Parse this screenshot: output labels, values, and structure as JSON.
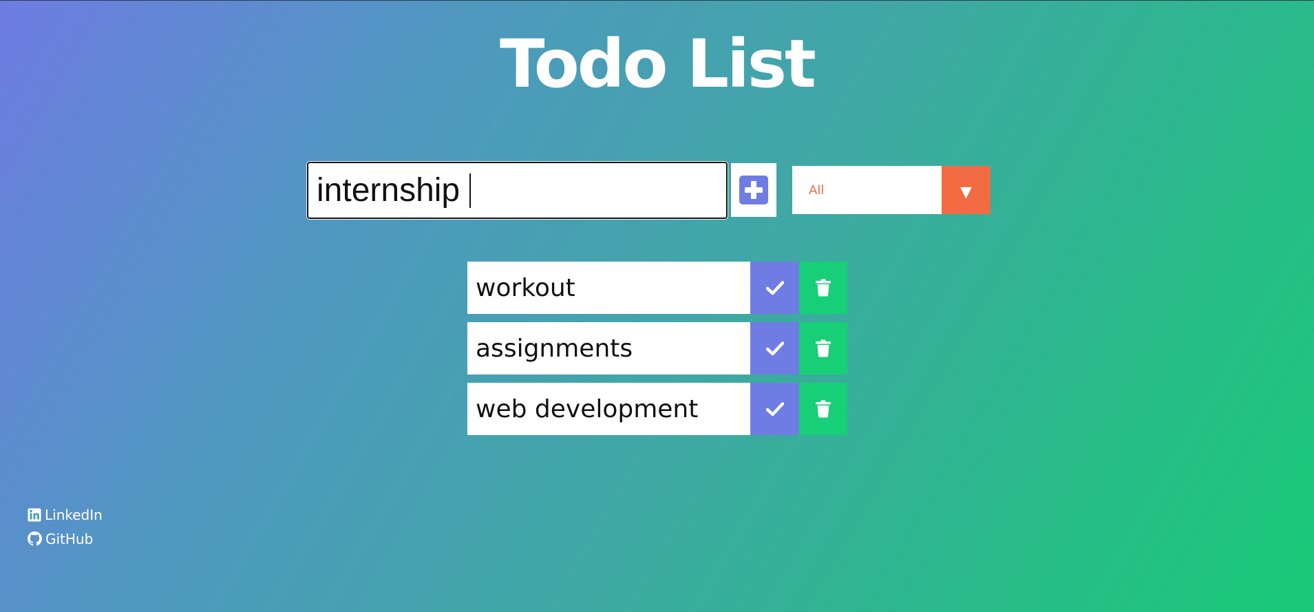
{
  "app": {
    "title": "Todo List"
  },
  "input": {
    "value": "internship"
  },
  "filter": {
    "selected": "All"
  },
  "todos": [
    {
      "text": "workout"
    },
    {
      "text": "assignments"
    },
    {
      "text": "web development"
    }
  ],
  "footer": {
    "links": [
      {
        "label": "LinkedIn",
        "icon": "linkedin-icon"
      },
      {
        "label": "GitHub",
        "icon": "github-icon"
      }
    ]
  },
  "colors": {
    "accent": "#6f7ce3",
    "filter": "#f26b43",
    "delete": "#17cf76"
  },
  "icons": {
    "add": "plus-square-icon",
    "filter": "caret-down-icon",
    "complete": "check-icon",
    "delete": "trash-icon"
  }
}
